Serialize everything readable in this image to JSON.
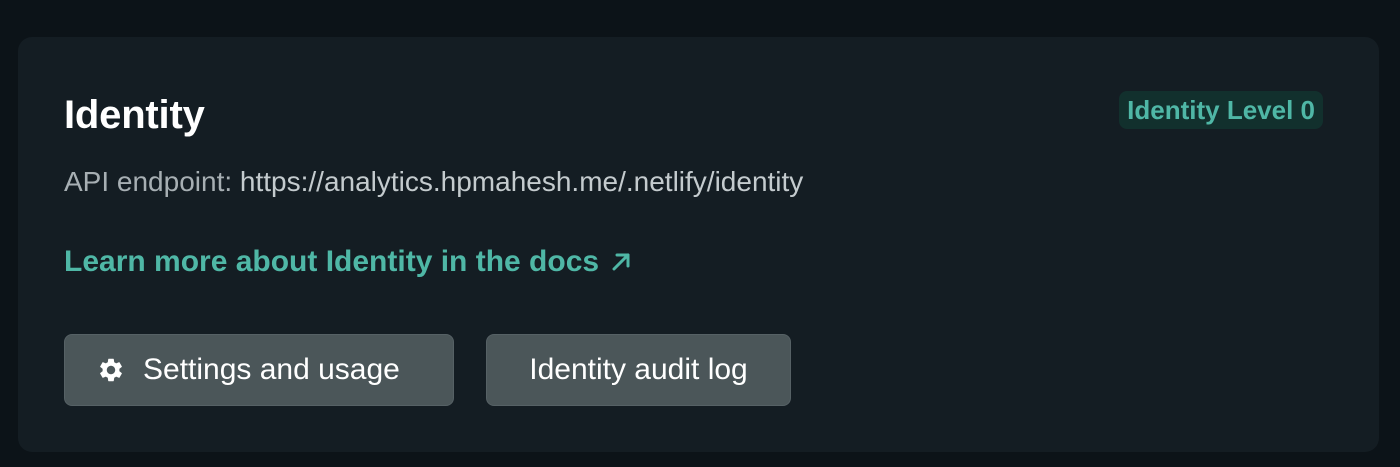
{
  "identity_card": {
    "title": "Identity",
    "level_badge": "Identity Level 0",
    "endpoint_label": "API endpoint:",
    "endpoint_url": "https://analytics.hpmahesh.me/.netlify/identity",
    "docs_link": "Learn more about Identity in the docs",
    "docs_link_icon": "external-arrow-icon",
    "buttons": {
      "settings_label": "Settings and usage",
      "settings_icon": "gear-icon",
      "audit_label": "Identity audit log"
    }
  },
  "colors": {
    "page_bg": "#0c1318",
    "card_bg": "#141d23",
    "accent": "#4fb7a6",
    "button_bg": "#4b5659"
  }
}
